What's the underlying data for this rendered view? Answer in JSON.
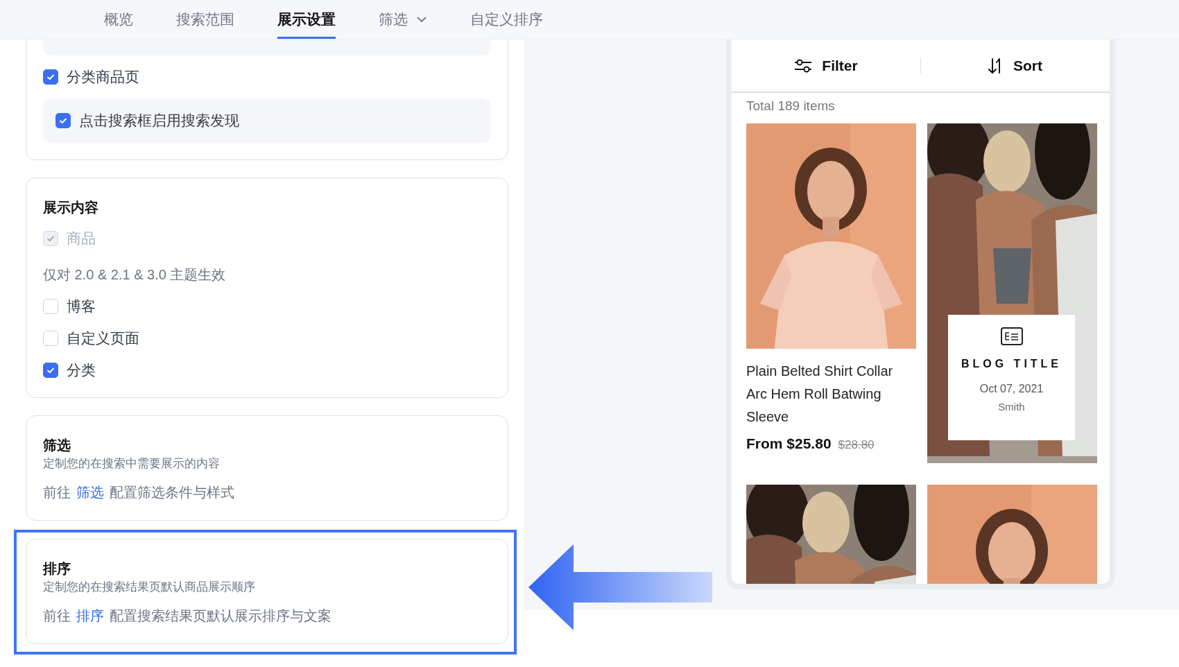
{
  "nav": {
    "tabs": [
      {
        "label": "概览",
        "selected": false,
        "dropdown": false
      },
      {
        "label": "搜索范围",
        "selected": false,
        "dropdown": false
      },
      {
        "label": "展示设置",
        "selected": true,
        "dropdown": false
      },
      {
        "label": "筛选",
        "selected": false,
        "dropdown": true
      },
      {
        "label": "自定义排序",
        "selected": false,
        "dropdown": false
      }
    ]
  },
  "sections": [
    {
      "kind": "options",
      "highlighted": false,
      "items": [
        {
          "kind": "group_box"
        },
        {
          "kind": "checkbox",
          "label": "分类商品页",
          "checked": true,
          "disabled": false
        },
        {
          "kind": "boxed_checkbox",
          "label": "点击搜索框启用搜索发现",
          "checked": true,
          "disabled": false
        }
      ]
    },
    {
      "kind": "options",
      "highlighted": false,
      "title": "展示内容",
      "items": [
        {
          "kind": "checkbox",
          "label": "商品",
          "checked": true,
          "disabled": true
        },
        {
          "kind": "note",
          "label": "仅对 2.0 & 2.1 & 3.0 主题生效"
        },
        {
          "kind": "checkbox",
          "label": "博客",
          "checked": false,
          "disabled": false
        },
        {
          "kind": "checkbox",
          "label": "自定义页面",
          "checked": false,
          "disabled": false
        },
        {
          "kind": "checkbox",
          "label": "分类",
          "checked": true,
          "disabled": false
        }
      ]
    },
    {
      "kind": "link",
      "highlighted": false,
      "title": "筛选",
      "description": "定制您的在搜索中需要展示的内容",
      "prefix": "前往",
      "link": "筛选",
      "suffix": "配置筛选条件与样式"
    },
    {
      "kind": "link",
      "highlighted": true,
      "title": "排序",
      "description": "定制您的在搜索结果页默认商品展示顺序",
      "prefix": "前往",
      "link": "排序",
      "suffix": "配置搜索结果页默认展示排序与文案"
    }
  ],
  "preview": {
    "filter": "Filter",
    "sort": "Sort",
    "total": "Total 189 items",
    "cards": [
      {
        "kind": "product",
        "title": "Plain Belted Shirt Collar Arc Hem Roll Batwing Sleeve",
        "price": "From $25.80",
        "original_price": "$28.80"
      },
      {
        "kind": "blog",
        "title": "BLOG TITLE",
        "date": "Oct 07, 2021",
        "author": "Smith"
      },
      {
        "kind": "picture"
      },
      {
        "kind": "picture"
      }
    ]
  }
}
